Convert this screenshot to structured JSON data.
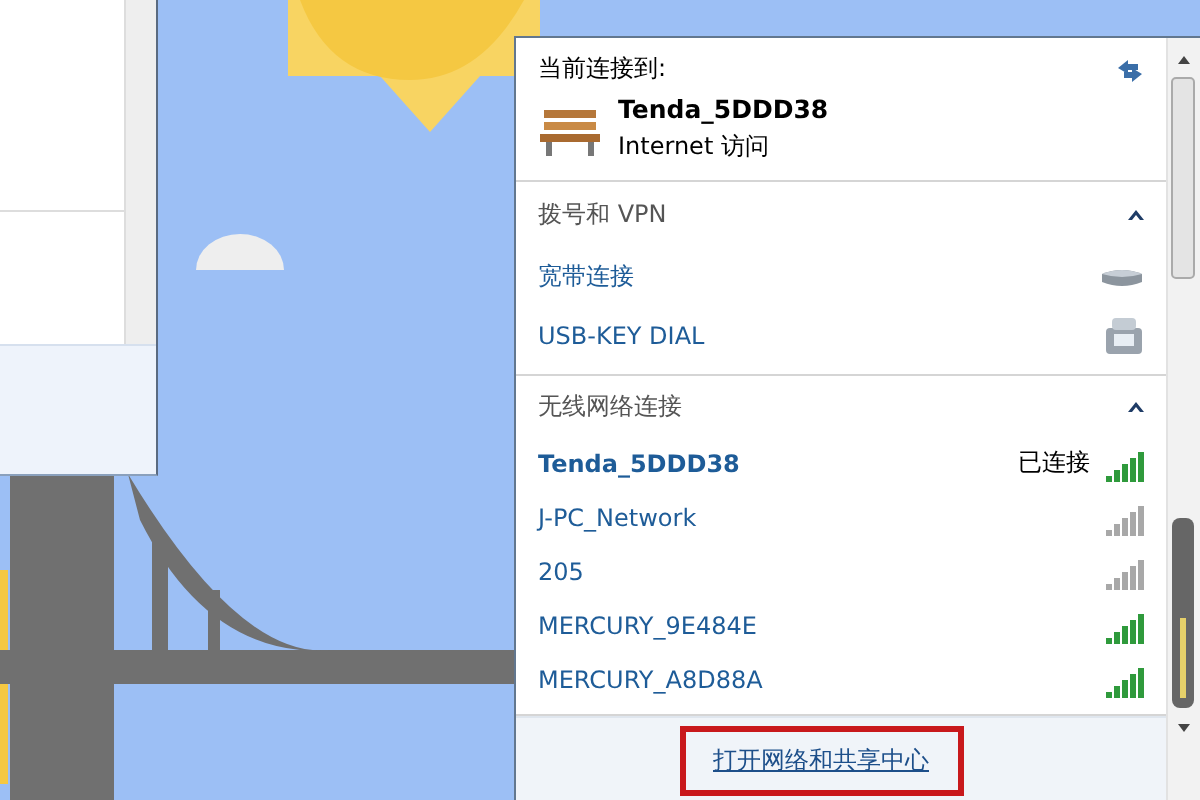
{
  "flyout": {
    "current_label": "当前连接到:",
    "current_network": {
      "name": "Tenda_5DDD38",
      "access": "Internet 访问"
    },
    "sections": [
      {
        "title": "拨号和 VPN",
        "expanded": true,
        "items": [
          {
            "kind": "broadband",
            "name": "宽带连接"
          },
          {
            "kind": "dialup",
            "name": "USB-KEY DIAL"
          }
        ]
      },
      {
        "title": "无线网络连接",
        "expanded": true,
        "items": [
          {
            "kind": "wifi",
            "name": "Tenda_5DDD38",
            "connected": true,
            "status": "已连接",
            "color": "#2f9a3c"
          },
          {
            "kind": "wifi",
            "name": "J-PC_Network",
            "connected": false,
            "color": "#a8a8a8"
          },
          {
            "kind": "wifi",
            "name": "205",
            "connected": false,
            "color": "#a8a8a8"
          },
          {
            "kind": "wifi",
            "name": "MERCURY_9E484E",
            "connected": false,
            "color": "#2f9a3c"
          },
          {
            "kind": "wifi",
            "name": "MERCURY_A8D88A",
            "connected": false,
            "color": "#2f9a3c"
          }
        ]
      }
    ],
    "footer": {
      "link": "打开网络和共享中心",
      "highlighted": true
    }
  }
}
